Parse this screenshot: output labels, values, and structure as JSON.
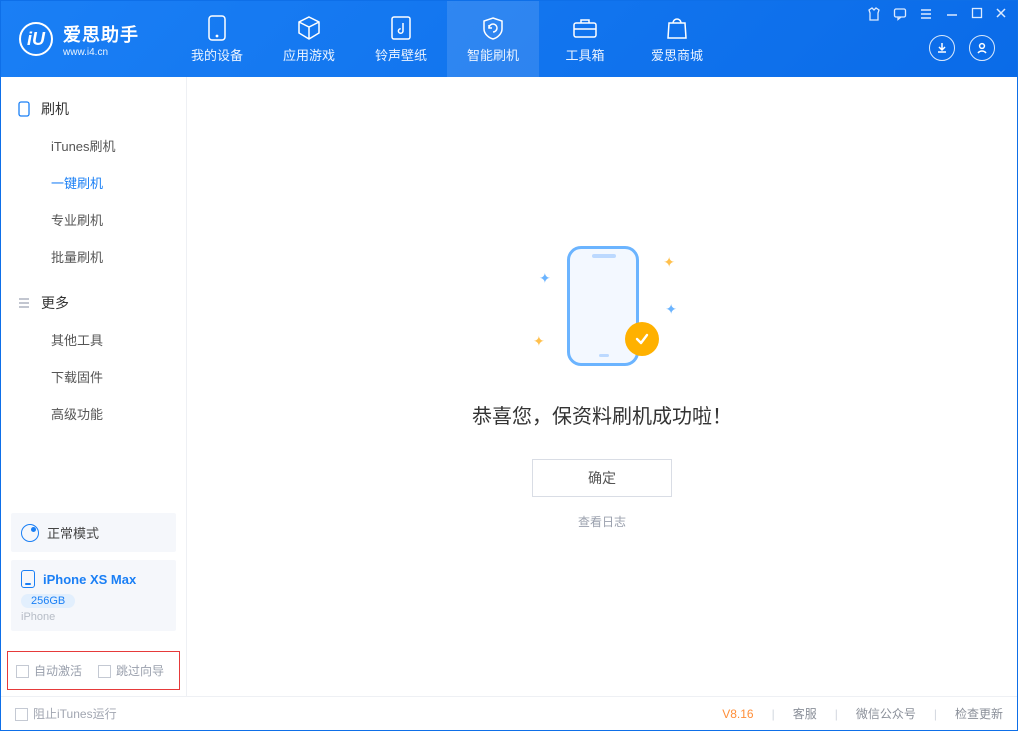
{
  "app": {
    "name": "爱思助手",
    "site": "www.i4.cn"
  },
  "tabs": {
    "device": "我的设备",
    "apps": "应用游戏",
    "ringtone": "铃声壁纸",
    "flash": "智能刷机",
    "toolbox": "工具箱",
    "store": "爱思商城"
  },
  "sidebar": {
    "group_flash": "刷机",
    "items_flash": {
      "itunes": "iTunes刷机",
      "oneclick": "一键刷机",
      "pro": "专业刷机",
      "batch": "批量刷机"
    },
    "group_more": "更多",
    "items_more": {
      "other": "其他工具",
      "download": "下载固件",
      "advanced": "高级功能"
    }
  },
  "mode": {
    "label": "正常模式"
  },
  "device": {
    "name": "iPhone XS Max",
    "capacity": "256GB",
    "type": "iPhone"
  },
  "checkboxes": {
    "auto_activate": "自动激活",
    "skip_guide": "跳过向导"
  },
  "main": {
    "result_text": "恭喜您，保资料刷机成功啦！",
    "confirm": "确定",
    "view_log": "查看日志"
  },
  "footer": {
    "block_itunes": "阻止iTunes运行",
    "version": "V8.16",
    "support": "客服",
    "wechat": "微信公众号",
    "check_update": "检查更新"
  }
}
